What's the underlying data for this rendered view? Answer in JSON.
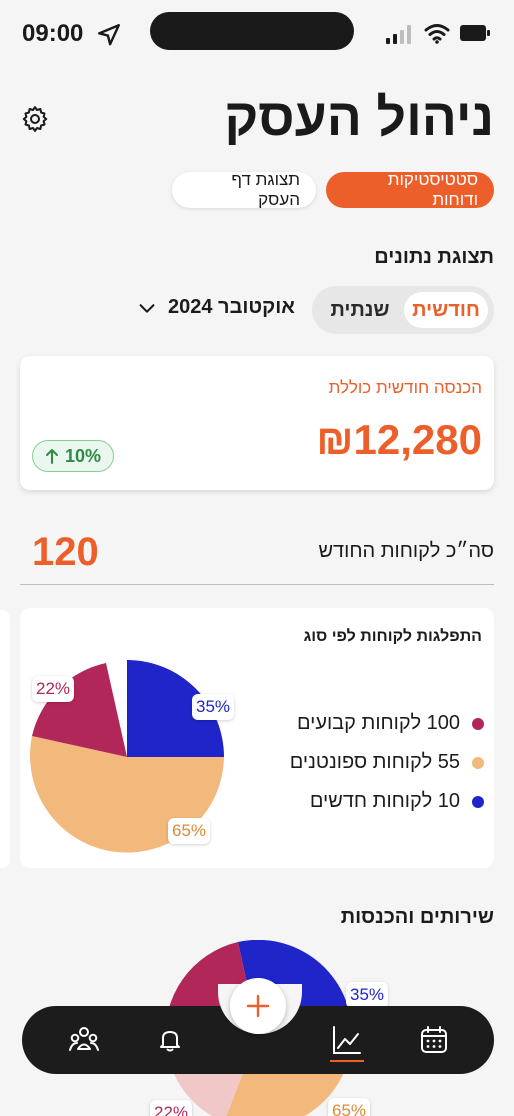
{
  "status_bar": {
    "time": "09:00"
  },
  "header": {
    "title": "ניהול העסק",
    "tabs": [
      {
        "label": "סטטיסטיקות ודוחות",
        "active": true
      },
      {
        "label": "תצוגת דף העסק",
        "active": false
      }
    ]
  },
  "data_view": {
    "label": "תצוגת נתונים",
    "segments": [
      {
        "label": "חודשית",
        "active": true
      },
      {
        "label": "שנתית",
        "active": false
      }
    ],
    "period": "אוקטובר 2024"
  },
  "revenue": {
    "label": "הכנסה חודשית כוללת",
    "value": "₪12,280",
    "growth": "10%",
    "growth_icon": "arrow-up-icon"
  },
  "customers": {
    "label": "סה״כ לקוחות החודש",
    "total": "120"
  },
  "distribution": {
    "title": "התפלגות לקוחות לפי סוג",
    "slices": [
      {
        "label": "35%",
        "value": 35,
        "color": "#1f25c9"
      },
      {
        "label": "65%",
        "value": 65,
        "color": "#f3b87c"
      },
      {
        "label": "22%",
        "value": 22,
        "color": "#b2275a"
      }
    ],
    "legend": [
      {
        "label": "100 לקוחות קבועים",
        "color": "#b2275a"
      },
      {
        "label": "55 לקוחות ספונטנים",
        "color": "#f3b87c"
      },
      {
        "label": "10 לקוחות חדשים",
        "color": "#1f25c9"
      }
    ]
  },
  "services": {
    "title": "שירותים והכנסות",
    "slices": [
      {
        "label": "35%",
        "color": "#1f25c9"
      },
      {
        "label": "65%",
        "color": "#f3b87c"
      },
      {
        "label": "22%",
        "color": "#b2275a"
      }
    ]
  },
  "bottom_nav": {
    "items": [
      {
        "icon": "people-icon",
        "active": false
      },
      {
        "icon": "bell-icon",
        "active": false
      },
      {
        "icon": "plus-icon",
        "active": false
      },
      {
        "icon": "chart-icon",
        "active": true
      },
      {
        "icon": "calendar-icon",
        "active": false
      }
    ],
    "accent": "#ec5f2a"
  }
}
